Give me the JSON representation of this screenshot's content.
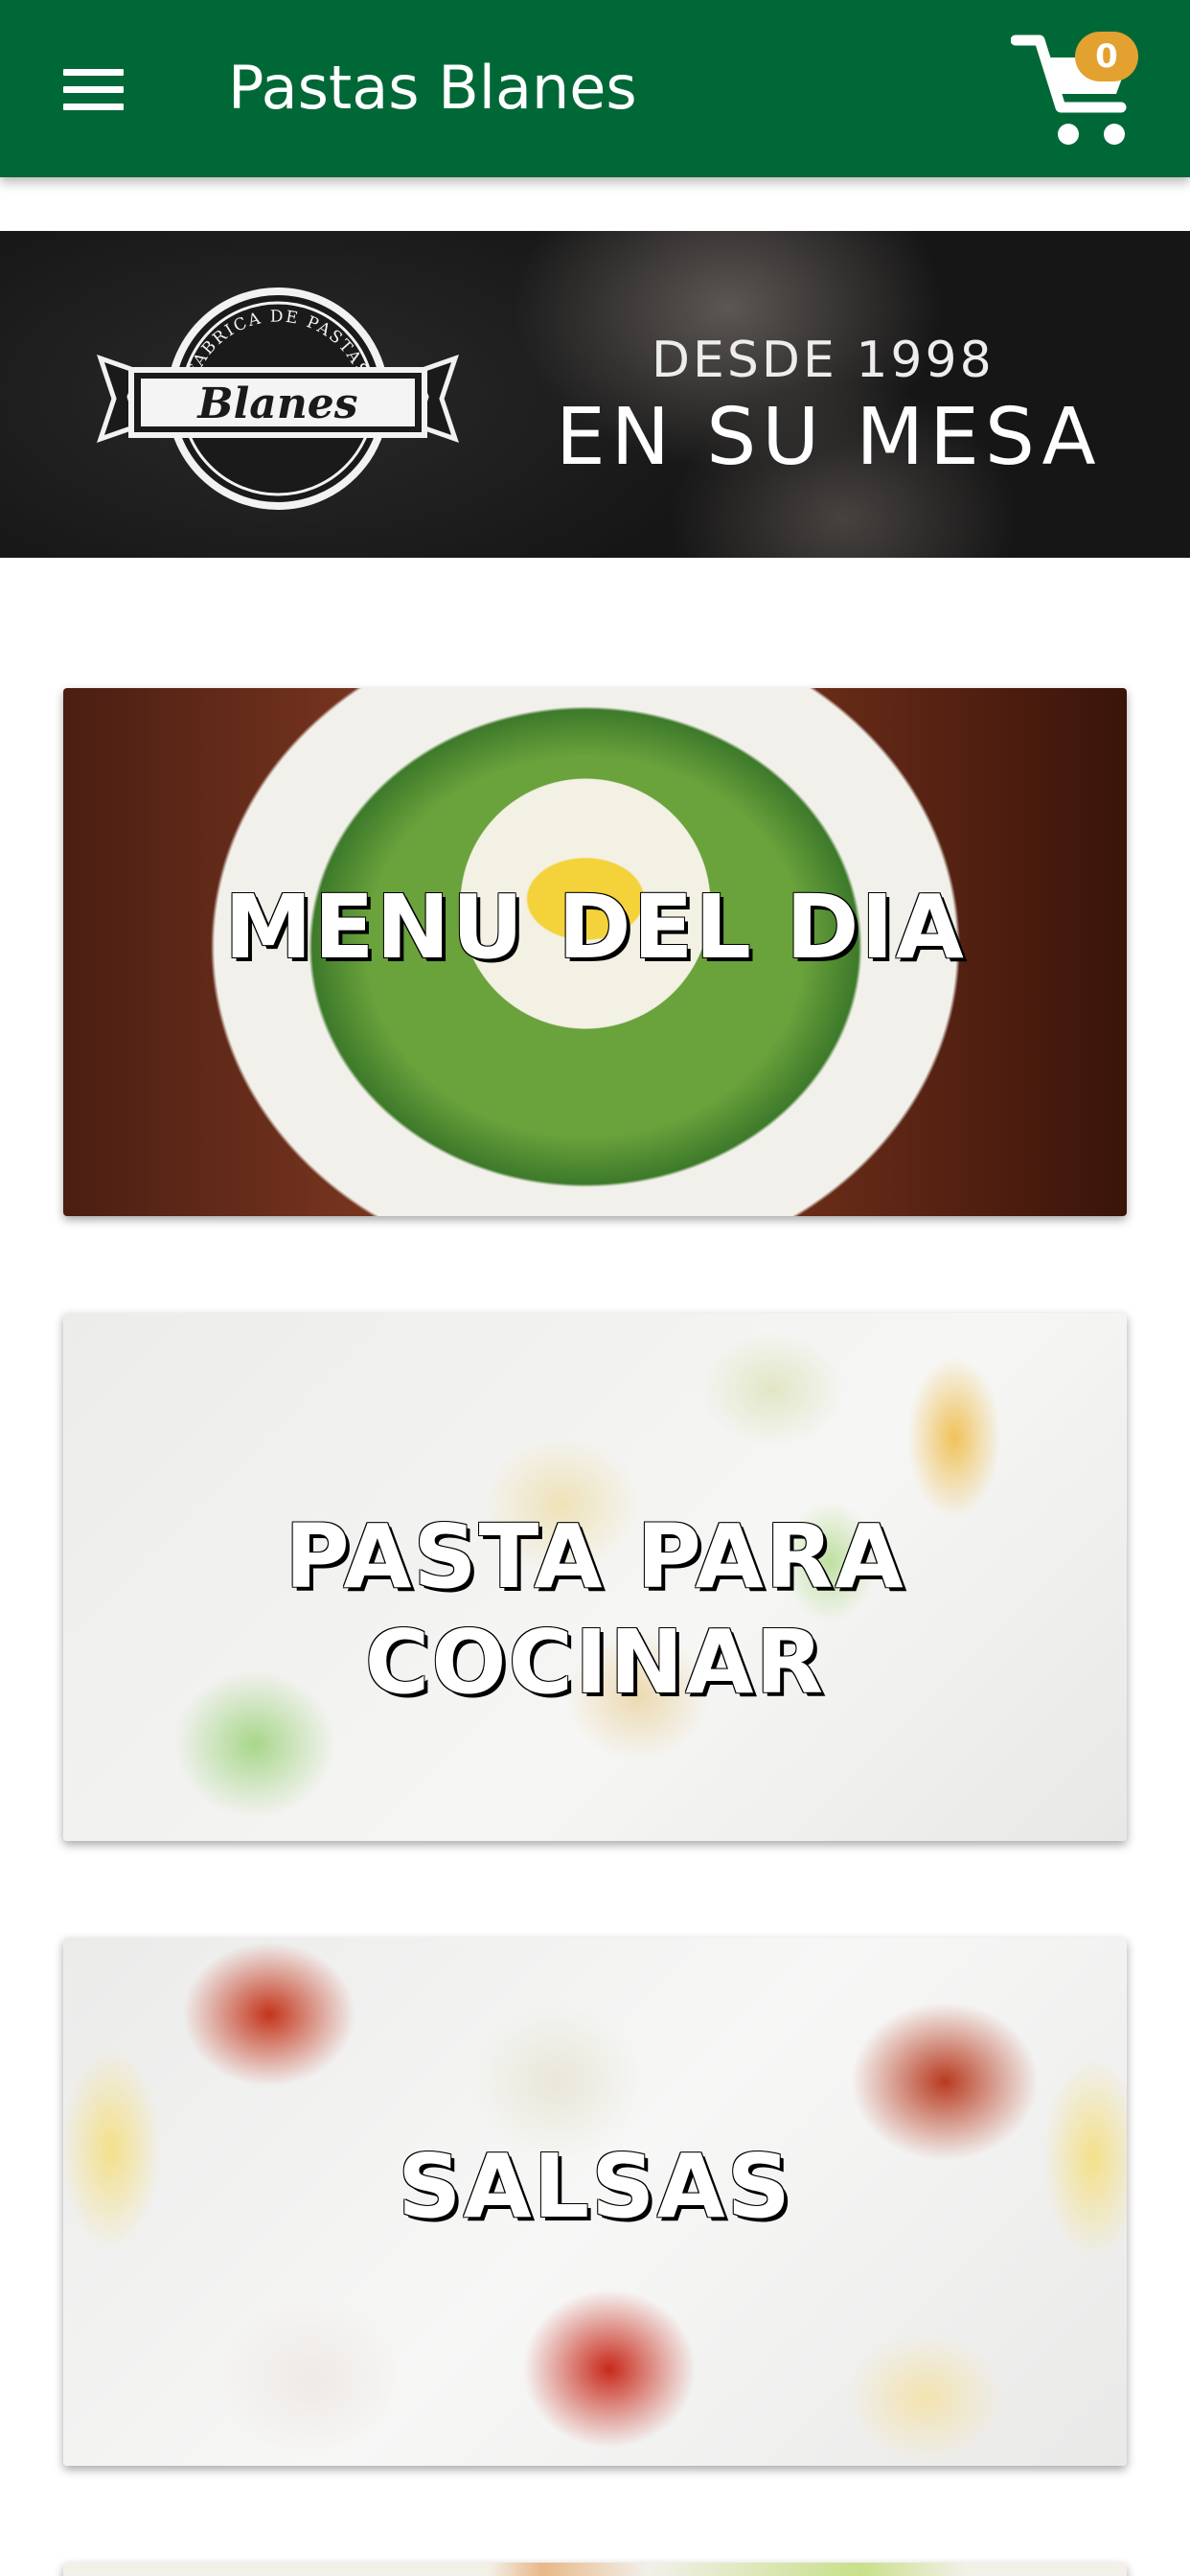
{
  "app_bar": {
    "title": "Pastas Blanes",
    "menu_icon": "hamburger-menu-icon",
    "cart_icon": "shopping-cart-icon",
    "cart_count": "0",
    "background_color": "#006837",
    "badge_color": "#e3a12f"
  },
  "banner": {
    "logo_brand": "Blanes",
    "logo_arc_text": "FÁBRICA DE PASTAS",
    "subtitle": "DESDE 1998",
    "headline": "EN SU MESA"
  },
  "categories": [
    {
      "label": "MENU DEL DIA"
    },
    {
      "label_line1": "PASTA PARA",
      "label_line2": "COCINAR"
    },
    {
      "label": "SALSAS"
    }
  ]
}
